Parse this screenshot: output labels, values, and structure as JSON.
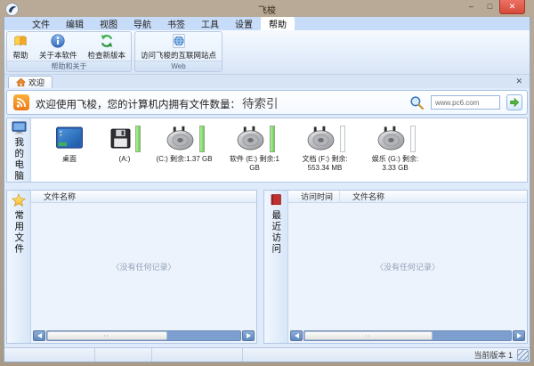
{
  "window": {
    "title": "飞梭",
    "controls": {
      "minimize": "–",
      "maximize": "□",
      "close": "✕"
    }
  },
  "menu": {
    "tabs": [
      "文件",
      "编辑",
      "视图",
      "导航",
      "书签",
      "工具",
      "设置",
      "帮助"
    ],
    "active_tab": "帮助"
  },
  "ribbon": {
    "buttons": {
      "help": "帮助",
      "about": "关于本软件",
      "check_update": "检查新版本",
      "visit_site": "访问飞梭的互联网站点"
    },
    "groups": {
      "help_about": "帮助和关于",
      "web": "Web"
    }
  },
  "doc_tabs": {
    "welcome": "欢迎",
    "close": "✕"
  },
  "welcome_bar": {
    "message": "欢迎使用飞梭，您的计算机内拥有文件数量：",
    "index_status": "待索引",
    "url_value": "www.pc6.com"
  },
  "my_computer": {
    "label": "我的电脑",
    "drives": [
      {
        "label": "桌面",
        "type": "desktop",
        "bar": "none"
      },
      {
        "label": "(A:)",
        "type": "floppy",
        "bar": "full"
      },
      {
        "label": "(C:) 剩余:1.37 GB",
        "type": "hdd",
        "bar": "full"
      },
      {
        "label": "软件 (E:) 剩余:1 GB",
        "type": "hdd",
        "bar": "full"
      },
      {
        "label": "文档 (F:) 剩余: 553.34 MB",
        "type": "hdd",
        "bar": "empty"
      },
      {
        "label": "娱乐 (G:) 剩余: 3.33 GB",
        "type": "hdd",
        "bar": "empty"
      }
    ]
  },
  "frequent_files": {
    "label": "常用文件",
    "columns": [
      "文件名称"
    ],
    "empty_text": "〈没有任何记录〉"
  },
  "recent_files": {
    "label": "最近访问",
    "columns": [
      "访问时间",
      "文件名称"
    ],
    "empty_text": "〈没有任何记录〉"
  },
  "status_bar": {
    "version": "当前版本 1"
  },
  "icons": {
    "app": "bird-logo",
    "help": "orange-book",
    "about": "info-circle",
    "check_update": "green-refresh-arrows",
    "visit_site": "globe-page",
    "welcome_tab": "home",
    "welcome_bar": "rss-feed",
    "search": "magnifier",
    "go": "green-arrow",
    "my_computer": "monitor",
    "desktop": "desktop-screen",
    "floppy": "floppy-disk",
    "hdd": "hard-disk-platter",
    "frequent": "yellow-star",
    "recent": "red-book"
  },
  "colors": {
    "frame_tan": "#ab9c89",
    "ribbon_blue": "#dfeafa",
    "scrollbar_blue": "#7d9fd0",
    "bar_green": "#6ecd56",
    "close_red": "#d64a3a",
    "go_green": "#52b53f"
  }
}
